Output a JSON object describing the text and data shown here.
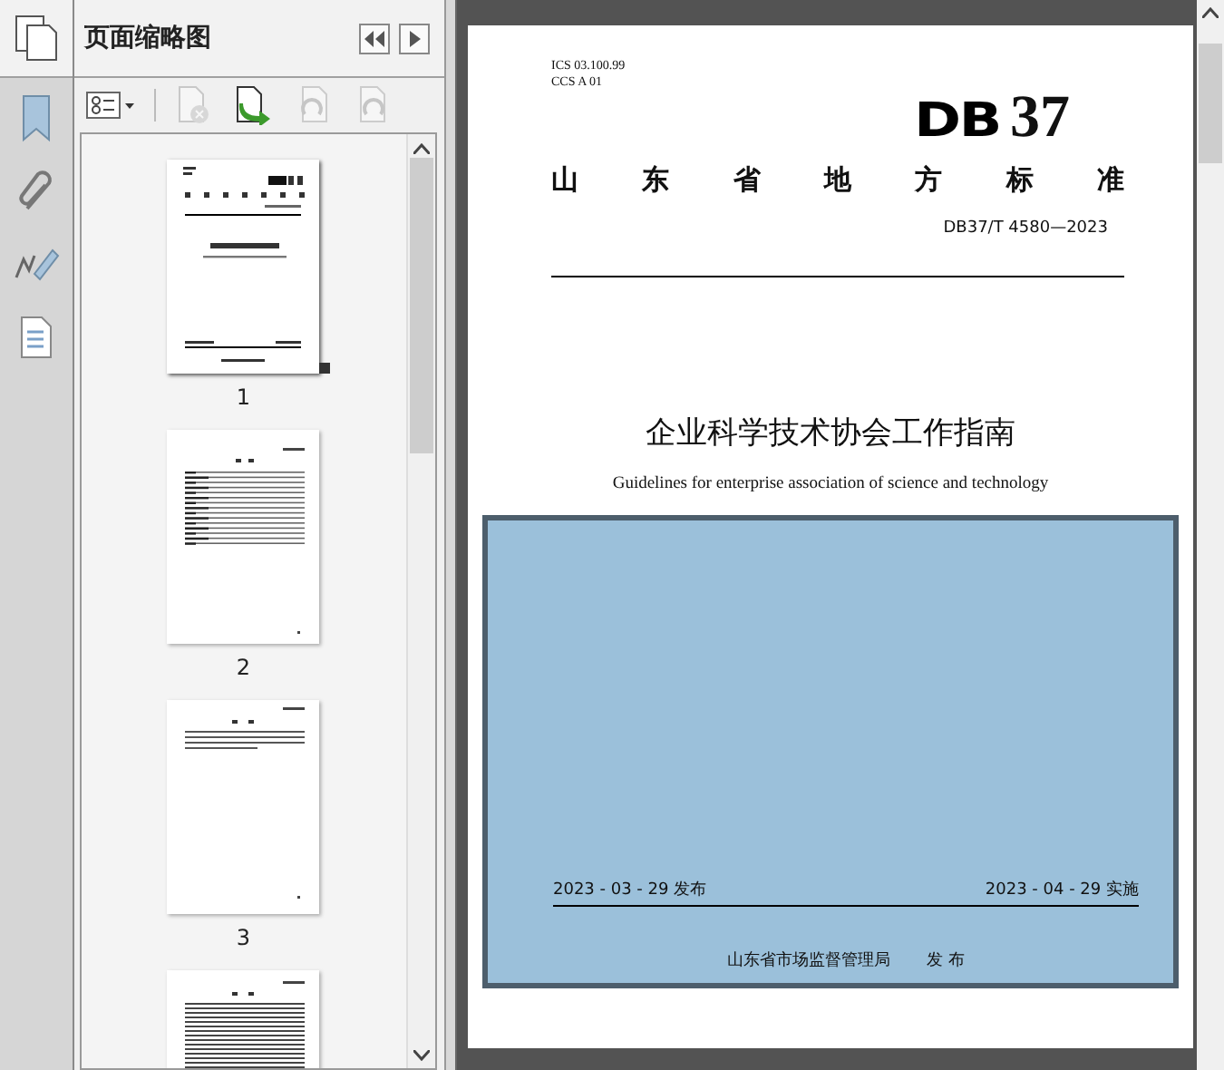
{
  "panel": {
    "title": "页面缩略图"
  },
  "thumbnails": [
    {
      "kind": "cover",
      "label": "1",
      "selected": true
    },
    {
      "kind": "contents",
      "label": "2",
      "selected": false
    },
    {
      "kind": "text",
      "label": "3",
      "selected": false
    },
    {
      "kind": "dense",
      "selected": false
    }
  ],
  "document": {
    "ics": "ICS  03.100.99",
    "ccs": "CCS  A  01",
    "logo": {
      "prefix": "DB",
      "number": "37"
    },
    "heading": [
      "山",
      "东",
      "省",
      "地",
      "方",
      "标",
      "准"
    ],
    "code": "DB37/T 4580—2023",
    "title": "企业科学技术协会工作指南",
    "subtitle": "Guidelines for enterprise association of science and technology",
    "issue_date": "2023 - 03 - 29 发布",
    "effective_date": "2023 - 04 - 29 实施",
    "issuer": "山东省市场监督管理局",
    "issuer_action": "发 布"
  }
}
